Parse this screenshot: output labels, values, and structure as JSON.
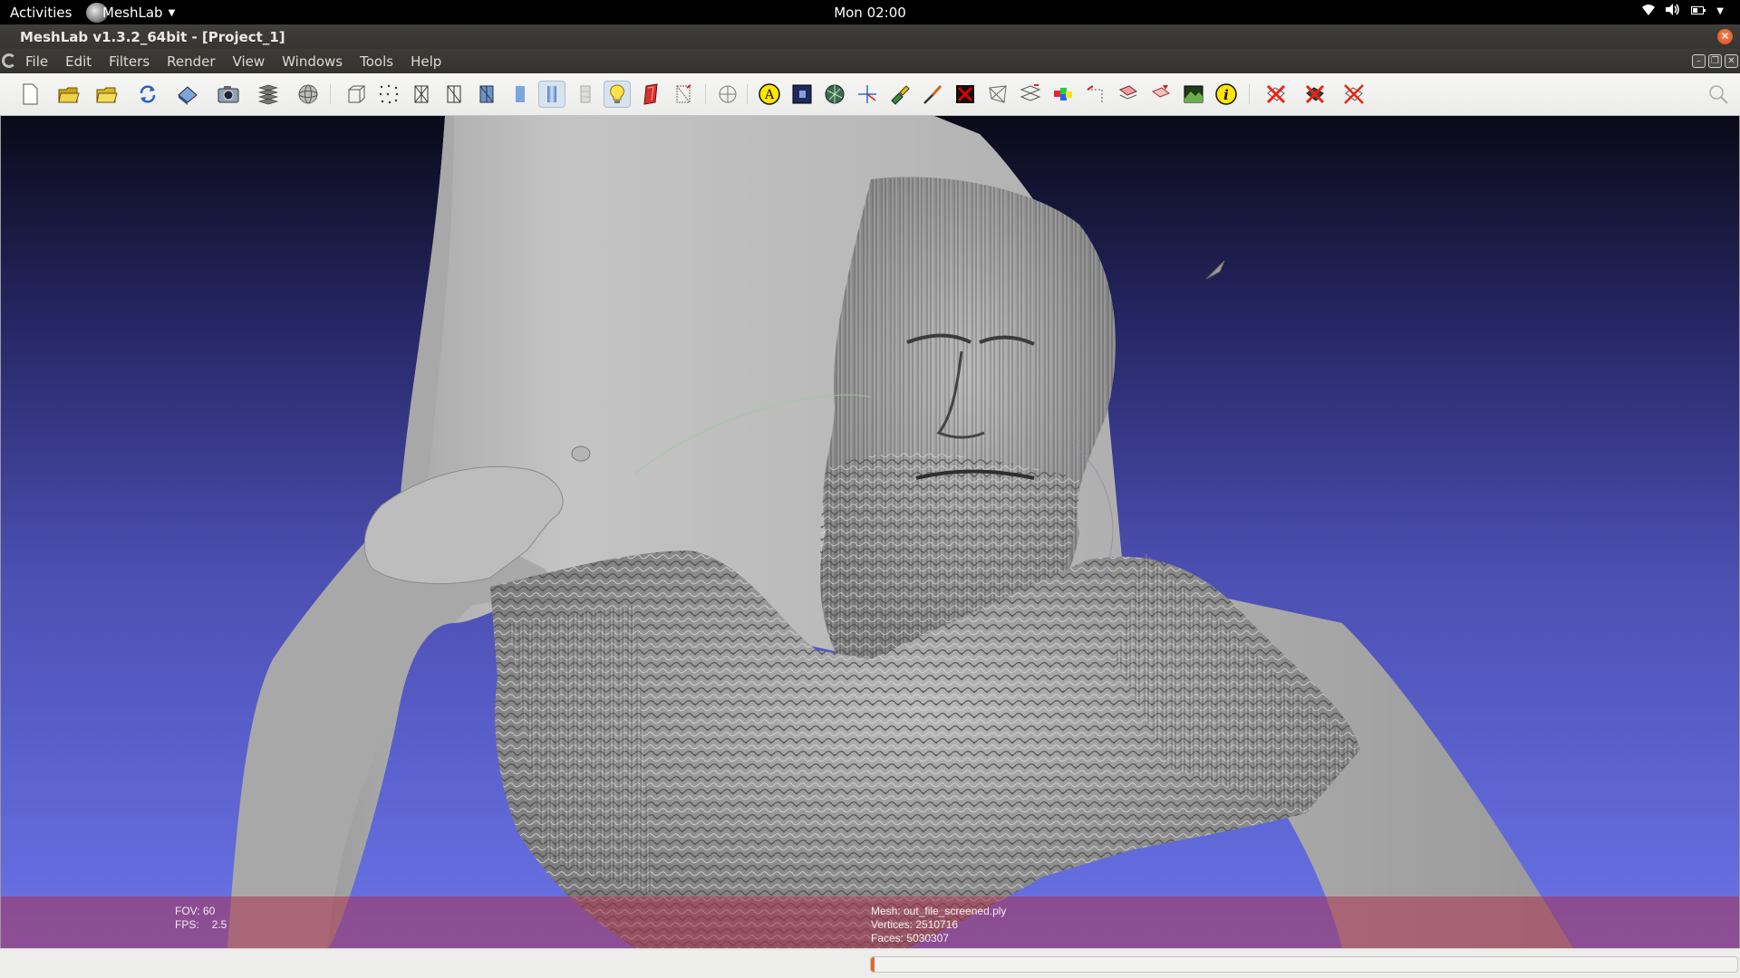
{
  "topbar": {
    "activities": "Activities",
    "app_name": "MeshLab",
    "clock": "Mon 02:00"
  },
  "window": {
    "title": "MeshLab v1.3.2_64bit - [Project_1]"
  },
  "menu": {
    "items": [
      {
        "label": "File"
      },
      {
        "label": "Edit"
      },
      {
        "label": "Filters"
      },
      {
        "label": "Render"
      },
      {
        "label": "View"
      },
      {
        "label": "Windows"
      },
      {
        "label": "Tools"
      },
      {
        "label": "Help"
      }
    ]
  },
  "toolbar": {
    "buttons": [
      {
        "icon": "new-project-icon"
      },
      {
        "icon": "open-project-icon"
      },
      {
        "icon": "import-mesh-icon"
      },
      {
        "icon": "reload-icon"
      },
      {
        "icon": "export-mesh-icon"
      },
      {
        "icon": "snapshot-icon"
      },
      {
        "icon": "layers-icon"
      },
      {
        "icon": "trackball-icon"
      },
      {
        "icon": "bounding-box-icon"
      },
      {
        "icon": "points-icon"
      },
      {
        "icon": "wireframe-icon"
      },
      {
        "icon": "hidden-lines-icon"
      },
      {
        "icon": "flat-lines-icon"
      },
      {
        "icon": "flat-icon"
      },
      {
        "icon": "smooth-icon"
      },
      {
        "icon": "texture-icon"
      },
      {
        "icon": "light-icon"
      },
      {
        "icon": "double-side-lighting-icon"
      },
      {
        "icon": "back-face-culling-icon"
      },
      {
        "icon": "axes-icon"
      },
      {
        "icon": "annotation-icon"
      },
      {
        "icon": "raster-icon"
      },
      {
        "icon": "select-faces-icon"
      },
      {
        "icon": "measure-icon"
      },
      {
        "icon": "paint-icon"
      },
      {
        "icon": "brush-icon"
      },
      {
        "icon": "select-connected-icon"
      },
      {
        "icon": "select-vertices-icon"
      },
      {
        "icon": "align-icon"
      },
      {
        "icon": "color-picker-icon"
      },
      {
        "icon": "manipulator-icon"
      },
      {
        "icon": "select-region-icon"
      },
      {
        "icon": "mutual-info-icon"
      },
      {
        "icon": "image-align-icon"
      },
      {
        "icon": "info-icon"
      },
      {
        "icon": "delete-faces-icon"
      },
      {
        "icon": "delete-vertices-icon"
      },
      {
        "icon": "delete-selection-icon"
      }
    ]
  },
  "viewport": {
    "background_top": "#0a0a17",
    "background_bottom": "#6a73e8",
    "fov_label": "FOV:",
    "fov_value": "60",
    "fps_label": "FPS:",
    "fps_value": "2.5",
    "mesh_label": "Mesh: out_file_screened.ply",
    "vertices_label": "Vertices: 2510716",
    "faces_label": "Faces: 5030307"
  },
  "statusbar": {
    "progress_fraction": 0.004,
    "progress_color": "#e06a2b"
  }
}
